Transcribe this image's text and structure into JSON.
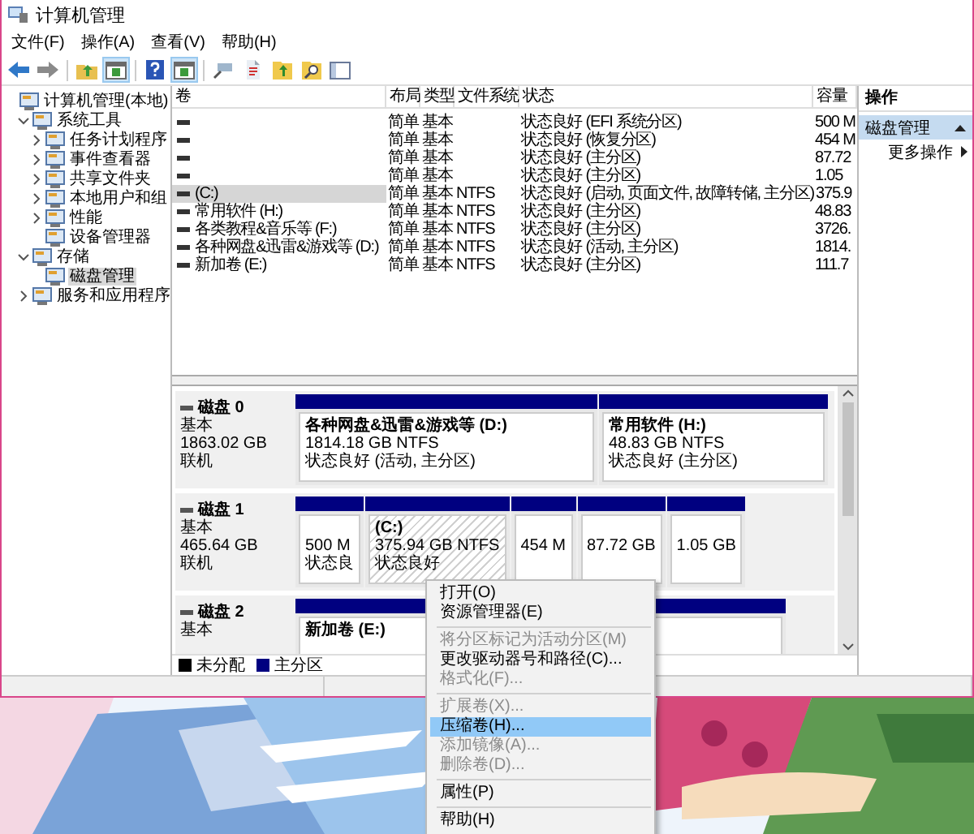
{
  "window": {
    "title": "计算机管理"
  },
  "menu_bar": [
    "文件(F)",
    "操作(A)",
    "查看(V)",
    "帮助(H)"
  ],
  "toolbar": [
    {
      "kind": "back",
      "pressed": false
    },
    {
      "kind": "forward",
      "pressed": false
    },
    {
      "kind": "separator"
    },
    {
      "kind": "up",
      "pressed": false
    },
    {
      "kind": "tree",
      "pressed": true
    },
    {
      "kind": "separator"
    },
    {
      "kind": "help",
      "pressed": false
    },
    {
      "kind": "panel",
      "pressed": true
    },
    {
      "kind": "separator"
    },
    {
      "kind": "connect",
      "pressed": false
    },
    {
      "kind": "check",
      "pressed": false
    },
    {
      "kind": "folder-up",
      "pressed": false
    },
    {
      "kind": "folder-search",
      "pressed": false
    },
    {
      "kind": "window",
      "pressed": false
    }
  ],
  "tree": [
    {
      "label": "计算机管理(本地)",
      "selected": false,
      "children": [
        {
          "label": "系统工具",
          "expanded": true,
          "selected": false,
          "children": [
            {
              "label": "任务计划程序",
              "expanded": false,
              "selected": false
            },
            {
              "label": "事件查看器",
              "expanded": false,
              "selected": false
            },
            {
              "label": "共享文件夹",
              "expanded": false,
              "selected": false
            },
            {
              "label": "本地用户和组",
              "expanded": false,
              "selected": false
            },
            {
              "label": "性能",
              "expanded": false,
              "selected": false
            },
            {
              "label": "设备管理器",
              "selected": false
            }
          ]
        },
        {
          "label": "存储",
          "expanded": true,
          "selected": false,
          "children": [
            {
              "label": "磁盘管理",
              "selected": true
            }
          ]
        },
        {
          "label": "服务和应用程序",
          "expanded": false,
          "selected": false
        }
      ]
    }
  ],
  "volume_table": {
    "columns": [
      "卷",
      "布局",
      "类型",
      "文件系统",
      "状态",
      "容量"
    ],
    "rows": [
      {
        "name": "",
        "layout": "简单",
        "type": "基本",
        "fs": "",
        "status": "状态良好 (EFI 系统分区)",
        "capacity": "500 M",
        "selected": false
      },
      {
        "name": "",
        "layout": "简单",
        "type": "基本",
        "fs": "",
        "status": "状态良好 (恢复分区)",
        "capacity": "454 M",
        "selected": false
      },
      {
        "name": "",
        "layout": "简单",
        "type": "基本",
        "fs": "",
        "status": "状态良好 (主分区)",
        "capacity": "87.72",
        "selected": false
      },
      {
        "name": "",
        "layout": "简单",
        "type": "基本",
        "fs": "",
        "status": "状态良好 (主分区)",
        "capacity": "1.05",
        "selected": false
      },
      {
        "name": "(C:)",
        "layout": "简单",
        "type": "基本",
        "fs": "NTFS",
        "status": "状态良好 (启动, 页面文件, 故障转储, 主分区)",
        "capacity": "375.9",
        "selected": true
      },
      {
        "name": "常用软件 (H:)",
        "layout": "简单",
        "type": "基本",
        "fs": "NTFS",
        "status": "状态良好 (主分区)",
        "capacity": "48.83",
        "selected": false
      },
      {
        "name": "各类教程&音乐等 (F:)",
        "layout": "简单",
        "type": "基本",
        "fs": "NTFS",
        "status": "状态良好 (主分区)",
        "capacity": "3726.",
        "selected": false
      },
      {
        "name": "各种网盘&迅雷&游戏等 (D:)",
        "layout": "简单",
        "type": "基本",
        "fs": "NTFS",
        "status": "状态良好 (活动, 主分区)",
        "capacity": "1814.",
        "selected": false
      },
      {
        "name": "新加卷 (E:)",
        "layout": "简单",
        "type": "基本",
        "fs": "NTFS",
        "status": "状态良好 (主分区)",
        "capacity": "111.7",
        "selected": false
      }
    ]
  },
  "disks": [
    {
      "name": "磁盘 0",
      "lines": [
        "基本",
        "1863.02 GB",
        "联机"
      ],
      "partitions": [
        {
          "name": "各种网盘&迅雷&游戏等  (D:)",
          "size": "1814.18 GB NTFS",
          "status": "状态良好 (活动, 主分区)",
          "selected": false
        },
        {
          "name": "常用软件  (H:)",
          "size": "48.83 GB NTFS",
          "status": "状态良好 (主分区)",
          "selected": false
        }
      ]
    },
    {
      "name": "磁盘 1",
      "lines": [
        "基本",
        "465.64 GB",
        "联机"
      ],
      "partitions": [
        {
          "size": "500 M",
          "status": "状态良",
          "selected": false
        },
        {
          "name": "(C:)",
          "size": "375.94 GB NTFS",
          "status": "状态良好",
          "selected": true
        },
        {
          "size": "454 M",
          "selected": false
        },
        {
          "size": "87.72 GB",
          "selected": false
        },
        {
          "size": "1.05 GB",
          "selected": false
        }
      ]
    },
    {
      "name": "磁盘 2",
      "lines": [
        "基本"
      ],
      "partitions": [
        {
          "name": "新加卷  (E:)",
          "selected": false
        }
      ]
    }
  ],
  "legend": [
    {
      "label": "未分配",
      "color": "#000000"
    },
    {
      "label": "主分区",
      "color": "#000080"
    }
  ],
  "actions": {
    "title": "操作",
    "section": "磁盘管理",
    "items": [
      "更多操作"
    ]
  },
  "context_menu": [
    {
      "kind": "item",
      "label": "打开(O)",
      "disabled": false,
      "selected": false
    },
    {
      "kind": "item",
      "label": "资源管理器(E)",
      "disabled": false,
      "selected": false
    },
    {
      "kind": "separator"
    },
    {
      "kind": "item",
      "label": "将分区标记为活动分区(M)",
      "disabled": true,
      "selected": false
    },
    {
      "kind": "item",
      "label": "更改驱动器号和路径(C)...",
      "disabled": false,
      "selected": false
    },
    {
      "kind": "item",
      "label": "格式化(F)...",
      "disabled": true,
      "selected": false
    },
    {
      "kind": "separator"
    },
    {
      "kind": "item",
      "label": "扩展卷(X)...",
      "disabled": true,
      "selected": false
    },
    {
      "kind": "item",
      "label": "压缩卷(H)...",
      "disabled": false,
      "selected": true
    },
    {
      "kind": "item",
      "label": "添加镜像(A)...",
      "disabled": true,
      "selected": false
    },
    {
      "kind": "item",
      "label": "删除卷(D)...",
      "disabled": true,
      "selected": false
    },
    {
      "kind": "separator"
    },
    {
      "kind": "item",
      "label": "属性(P)",
      "disabled": false,
      "selected": false
    },
    {
      "kind": "separator"
    },
    {
      "kind": "item",
      "label": "帮助(H)",
      "disabled": false,
      "selected": false
    }
  ],
  "wallpaper": {
    "kind": "picture"
  }
}
